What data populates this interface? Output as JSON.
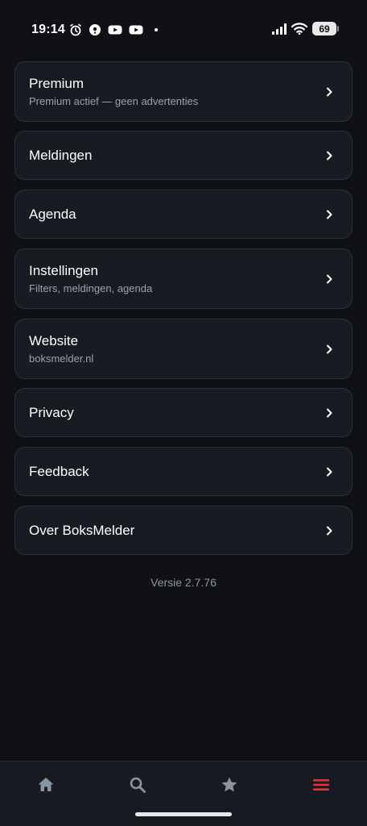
{
  "status_bar": {
    "time": "19:14",
    "battery": "69",
    "icons_left": [
      "alarm-icon",
      "location-icon",
      "youtube-icon",
      "youtube-icon",
      "notification-dot"
    ],
    "icons_right": [
      "signal-icon",
      "wifi-icon",
      "battery-icon"
    ]
  },
  "menu": {
    "items": [
      {
        "title": "Premium",
        "subtitle": "Premium actief — geen advertenties"
      },
      {
        "title": "Meldingen"
      },
      {
        "title": "Agenda"
      },
      {
        "title": "Instellingen",
        "subtitle": "Filters, meldingen, agenda"
      },
      {
        "title": "Website",
        "subtitle": "boksmelder.nl"
      },
      {
        "title": "Privacy"
      },
      {
        "title": "Feedback"
      },
      {
        "title": "Over BoksMelder"
      }
    ]
  },
  "version": "Versie 2.7.76",
  "bottom_nav": {
    "items": [
      {
        "icon": "home-icon",
        "active": false
      },
      {
        "icon": "search-icon",
        "active": false
      },
      {
        "icon": "star-icon",
        "active": false
      },
      {
        "icon": "menu-icon",
        "active": true
      }
    ]
  },
  "colors": {
    "background": "#0f1115",
    "card": "#181c22",
    "card_border": "#2b313a",
    "subtitle": "#9aa1ab",
    "nav_icon": "#8a93a0",
    "accent": "#e0333b"
  }
}
